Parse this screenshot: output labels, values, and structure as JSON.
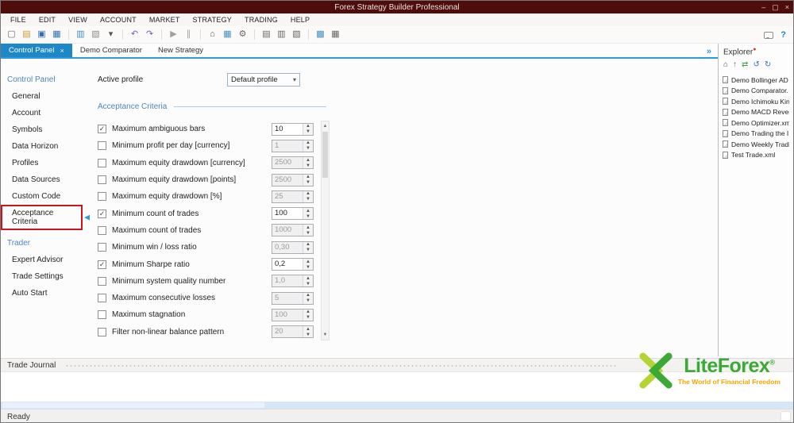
{
  "colors": {
    "titlebar": "#4e0d0a",
    "accent_blue": "#2e9ad8",
    "tab_active_blue": "#1e87c8",
    "section_blue": "#4f86c2",
    "highlight_red": "#c9151e",
    "logo_green": "#3aaa35",
    "logo_lightgreen": "#b5d334",
    "logo_orange": "#f7a600",
    "scrollbar_blue": "#d5e6f7"
  },
  "glyphs": {
    "checkbox_check": "✓",
    "spinner_up": "▲",
    "spinner_down": "▼",
    "selected_arrow": "◀",
    "select_caret": "▾",
    "explorer_badge": "●"
  },
  "window": {
    "title": "Forex Strategy Builder Professional",
    "controls": {
      "minimize": "–",
      "maximize": "▢",
      "close": "×"
    }
  },
  "menu": {
    "items": [
      "FILE",
      "EDIT",
      "VIEW",
      "ACCOUNT",
      "MARKET",
      "STRATEGY",
      "TRADING",
      "HELP"
    ]
  },
  "toolbar": {
    "icons": [
      {
        "name": "new-document-icon",
        "glyph": "▢",
        "color": "#6b6b6b"
      },
      {
        "name": "open-folder-icon",
        "glyph": "▤",
        "color": "#c9972f"
      },
      {
        "name": "save-icon",
        "glyph": "▣",
        "color": "#2f6fae"
      },
      {
        "name": "save-all-icon",
        "glyph": "▦",
        "color": "#2f6fae"
      },
      {
        "separator": true
      },
      {
        "name": "journal-chart-icon",
        "glyph": "▥",
        "color": "#3f8fc4"
      },
      {
        "name": "copy-strategy-icon",
        "glyph": "▧",
        "color": "#8a8a8a"
      },
      {
        "name": "dropdown-caret-icon",
        "glyph": "▾",
        "color": "#555555"
      },
      {
        "separator": true
      },
      {
        "name": "undo-icon",
        "glyph": "↶",
        "color": "#7b5bb5"
      },
      {
        "name": "redo-icon",
        "glyph": "↷",
        "color": "#7b5bb5"
      },
      {
        "separator": true
      },
      {
        "name": "play-icon",
        "glyph": "▶",
        "color": "#a0a0a0"
      },
      {
        "name": "pause-icon",
        "glyph": "∥",
        "color": "#a0a0a0"
      },
      {
        "separator": true
      },
      {
        "name": "home-icon",
        "glyph": "⌂",
        "color": "#555555"
      },
      {
        "name": "indicators-grid-icon",
        "glyph": "▦",
        "color": "#3f8fc4"
      },
      {
        "name": "gear-icon",
        "glyph": "⚙",
        "color": "#666666"
      },
      {
        "separator": true
      },
      {
        "name": "journal-list-icon",
        "glyph": "▤",
        "color": "#666666"
      },
      {
        "name": "account-table-icon",
        "glyph": "▥",
        "color": "#666666"
      },
      {
        "name": "layout-icon",
        "glyph": "▧",
        "color": "#666666"
      },
      {
        "separator": true
      },
      {
        "name": "comparator-chart-icon",
        "glyph": "▩",
        "color": "#3f8fc4"
      },
      {
        "name": "calculator-icon",
        "glyph": "▦",
        "color": "#666666"
      }
    ],
    "help_label": "?"
  },
  "tabs": {
    "items": [
      {
        "label": "Control Panel",
        "active": true
      },
      {
        "label": "Demo Comparator",
        "active": false
      },
      {
        "label": "New Strategy",
        "active": false
      }
    ],
    "close_glyph": "×",
    "overflow_glyph": "»"
  },
  "sidebar": {
    "selected": "Acceptance Criteria",
    "sections": [
      {
        "header": "Control Panel",
        "items": [
          "General",
          "Account",
          "Symbols",
          "Data Horizon",
          "Profiles",
          "Data Sources",
          "Custom Code",
          "Acceptance Criteria"
        ]
      },
      {
        "header": "Trader",
        "items": [
          "Expert Advisor",
          "Trade Settings",
          "Auto Start"
        ]
      }
    ]
  },
  "content": {
    "active_profile_label": "Active profile",
    "active_profile_value": "Default profile",
    "section_title": "Acceptance Criteria",
    "criteria": [
      {
        "label": "Maximum ambiguous bars",
        "checked": true,
        "value": "10"
      },
      {
        "label": "Minimum profit per day [currency]",
        "checked": false,
        "value": "1"
      },
      {
        "label": "Maximum equity drawdown [currency]",
        "checked": false,
        "value": "2500"
      },
      {
        "label": "Maximum equity drawdown [points]",
        "checked": false,
        "value": "2500"
      },
      {
        "label": "Maximum equity drawdown [%]",
        "checked": false,
        "value": "25"
      },
      {
        "label": "Minimum count of trades",
        "checked": true,
        "value": "100"
      },
      {
        "label": "Maximum count of trades",
        "checked": false,
        "value": "1000"
      },
      {
        "label": "Minimum win / loss ratio",
        "checked": false,
        "value": "0,30"
      },
      {
        "label": "Minimum Sharpe ratio",
        "checked": true,
        "value": "0,2"
      },
      {
        "label": "Minimum system quality number",
        "checked": false,
        "value": "1,0"
      },
      {
        "label": "Maximum consecutive losses",
        "checked": false,
        "value": "5"
      },
      {
        "label": "Maximum stagnation",
        "checked": false,
        "value": "100"
      },
      {
        "label": "Filter non-linear balance pattern",
        "checked": false,
        "value": "20"
      }
    ]
  },
  "explorer": {
    "title": "Explorer",
    "tools": [
      {
        "name": "home-icon",
        "glyph": "⌂",
        "color": "#555555"
      },
      {
        "name": "up-icon",
        "glyph": "↑",
        "color": "#2f6fae"
      },
      {
        "name": "refresh-icon",
        "glyph": "⇄",
        "color": "#3a9b3a"
      },
      {
        "name": "back-icon",
        "glyph": "↺",
        "color": "#2f6fae"
      },
      {
        "name": "forward-icon",
        "glyph": "↻",
        "color": "#2f6fae"
      }
    ],
    "files": [
      "Demo Bollinger AD",
      "Demo Comparator.",
      "Demo Ichimoku Kin",
      "Demo MACD Rever",
      "Demo Optimizer.xml",
      "Demo Trading the I",
      "Demo Weekly Tradi",
      "Test Trade.xml"
    ]
  },
  "journal": {
    "label": "Trade Journal"
  },
  "logo": {
    "name": "LiteForex",
    "registered": "®",
    "tagline": "The World of Financial Freedom"
  },
  "statusbar": {
    "text": "Ready"
  }
}
